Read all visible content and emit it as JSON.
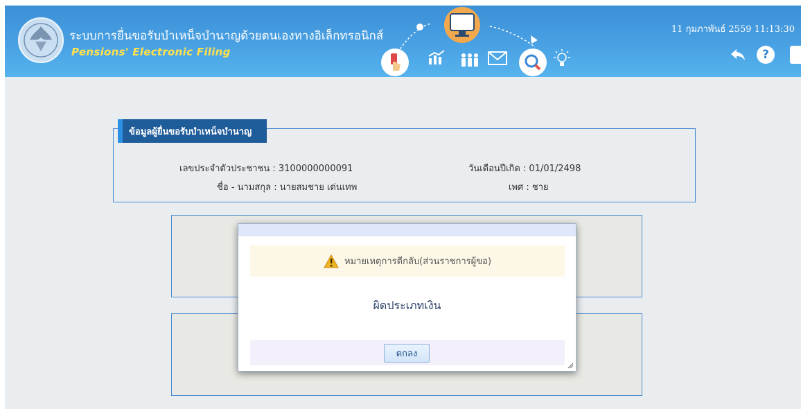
{
  "header": {
    "title_th": "ระบบการยื่นขอรับบำเหน็จบำนาญด้วยตนเองทางอิเล็กทรอนิกส์",
    "title_en": "Pensions' Electronic Filing",
    "datetime": "11 กุมภาพันธ์ 2559 11:13:30",
    "help_label": "?",
    "icons": [
      "seal-logo",
      "touch-icon",
      "chart-icon",
      "people-icon",
      "mail-icon",
      "monitor-icon",
      "search-icon",
      "lightbulb-icon",
      "back-icon",
      "help-icon"
    ]
  },
  "applicant": {
    "legend": "ข้อมูลผู้ยื่นขอรับบำเหน็จบำนาญ",
    "id_label": "เลขประจำตัวประชาชน : ",
    "id_value": "3100000000091",
    "name_label": "ชื่อ - นามสกุล : ",
    "name_value": "นายสมชาย เด่นเทพ",
    "dob_label": "วันเดือนปีเกิด : ",
    "dob_value": "01/01/2498",
    "sex_label": "เพศ : ",
    "sex_value": "ชาย"
  },
  "dialog": {
    "warning": "หมายเหตุการตีกลับ(ส่วนราชการผู้ขอ)",
    "message": "ผิดประเภทเงิน",
    "ok_label": "ตกลง"
  },
  "colors": {
    "header_blue": "#4aa3e4",
    "accent_yellow": "#ffe14a",
    "legend_bg": "#1f5c9a",
    "border_blue": "#4a8bd4",
    "warning_bg": "#fcf7e6"
  }
}
